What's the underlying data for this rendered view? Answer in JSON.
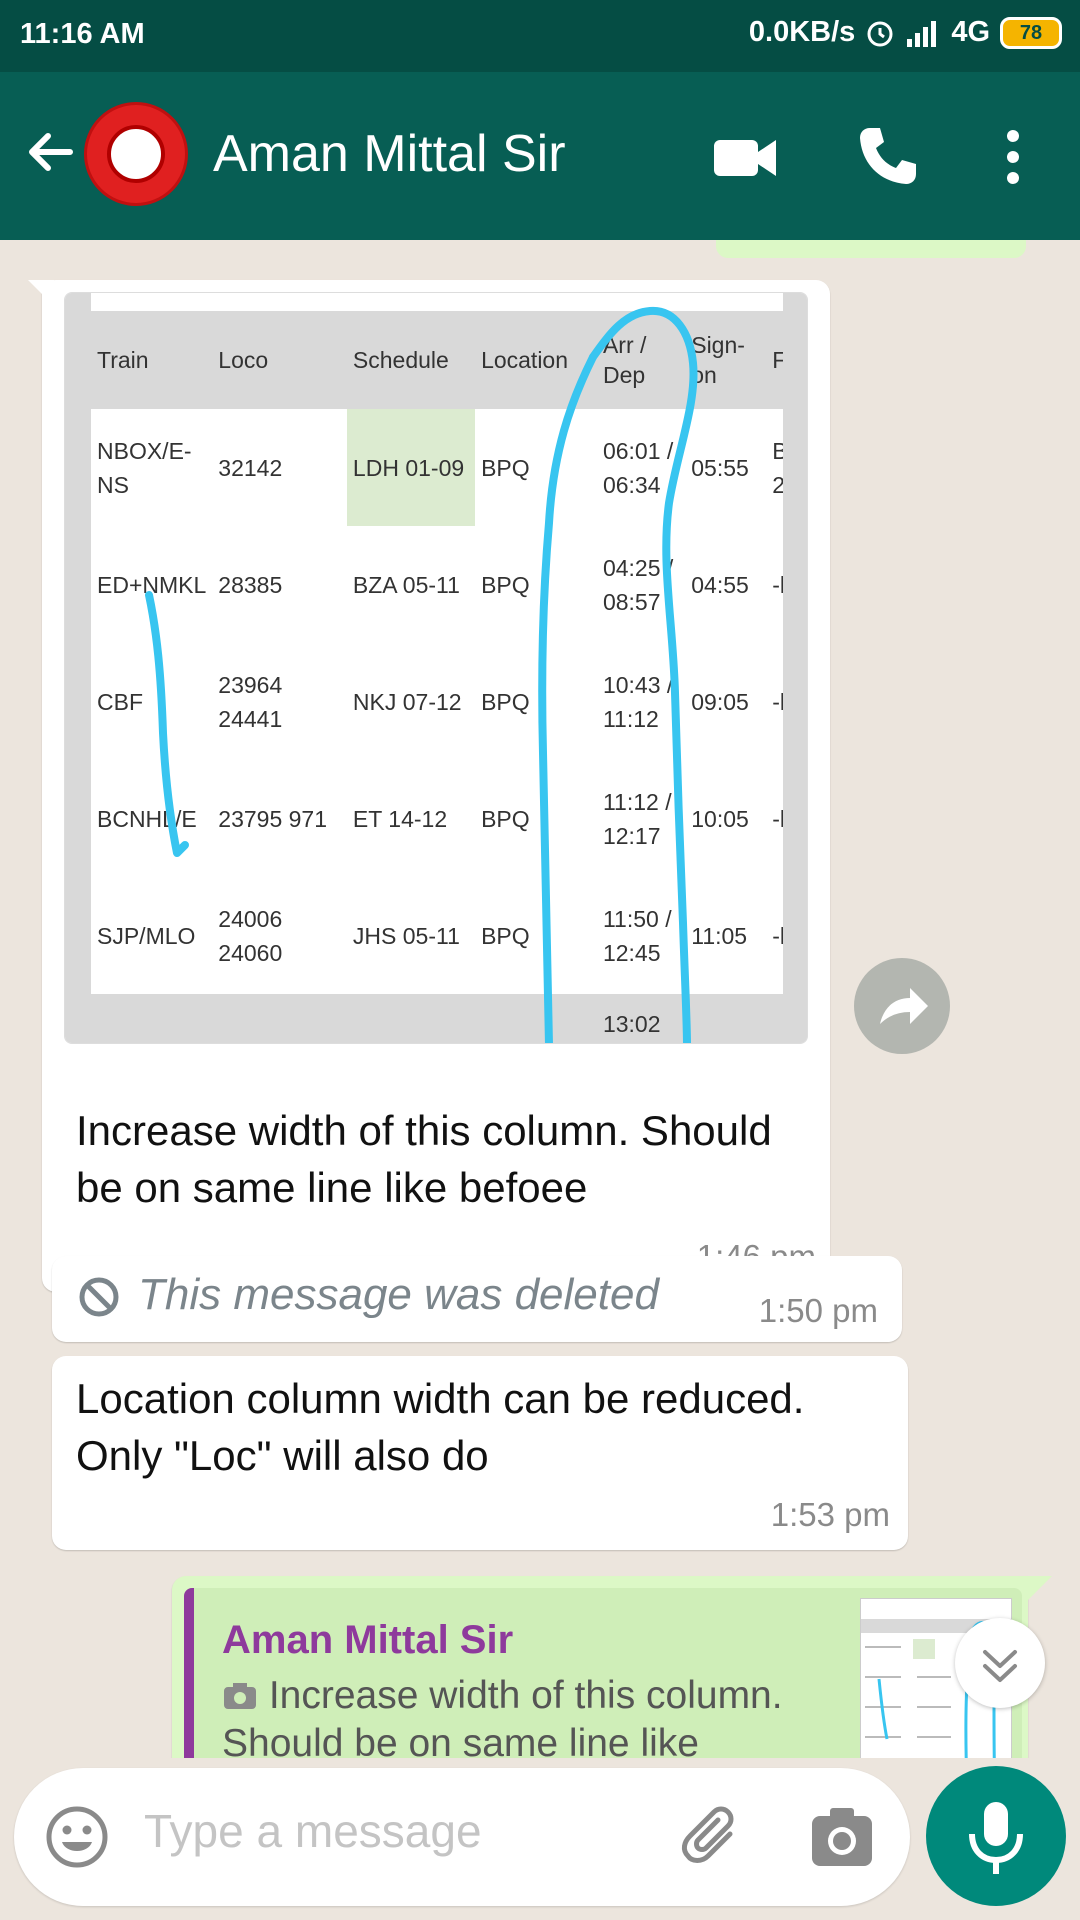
{
  "status_bar": {
    "time": "11:16 AM",
    "network_speed": "0.0KB/s",
    "network_type": "4G",
    "battery": "78"
  },
  "header": {
    "contact_name": "Aman Mittal Sir",
    "icons": [
      "back-arrow-icon",
      "railway-logo-avatar",
      "video-call-icon",
      "phone-call-icon",
      "more-vert-icon"
    ]
  },
  "messages": {
    "image_message": {
      "table": {
        "headers": [
          "Train",
          "Loco",
          "Schedule",
          "Location",
          "Arr / Dep",
          "Sign-on",
          "F"
        ],
        "rows": [
          {
            "train": "NBOX/E-NS",
            "loco": "32142",
            "schedule": "LDH 01-09",
            "location": "BPQ",
            "arrdep": "06:01 / 06:34",
            "signon": "05:55",
            "f": "B 2"
          },
          {
            "train": "ED+NMKL",
            "loco": "28385",
            "schedule": "BZA 05-11",
            "location": "BPQ",
            "arrdep": "04:25 / 08:57",
            "signon": "04:55",
            "f": "-l"
          },
          {
            "train": "CBF",
            "loco": "23964 24441",
            "schedule": "NKJ 07-12",
            "location": "BPQ",
            "arrdep": "10:43 / 11:12",
            "signon": "09:05",
            "f": "-l"
          },
          {
            "train": "BCNHL/E",
            "loco": "23795 971",
            "schedule": "ET 14-12",
            "location": "BPQ",
            "arrdep": "11:12 / 12:17",
            "signon": "10:05",
            "f": "-l"
          },
          {
            "train": "SJP/MLO",
            "loco": "24006 24060",
            "schedule": "JHS 05-11",
            "location": "BPQ",
            "arrdep": "11:50 / 12:45",
            "signon": "11:05",
            "f": "-l"
          },
          {
            "train": "",
            "loco": "",
            "schedule": "",
            "location": "",
            "arrdep": "13:02",
            "signon": "",
            "f": ""
          }
        ]
      },
      "caption": "Increase width of this column. Should be on same line like befoee",
      "time": "1:46 pm"
    },
    "deleted_message": {
      "text": "This message was deleted",
      "time": "1:50 pm"
    },
    "text_message": {
      "text": "Location column width can be reduced. Only \"Loc\" will also do",
      "time": "1:53 pm"
    },
    "reply_message": {
      "quoted_author": "Aman Mittal Sir",
      "quoted_text": "Increase width of this column. Should be on same line like"
    }
  },
  "composer": {
    "placeholder": "Type a message"
  },
  "colors": {
    "status_bar": "#054d44",
    "app_bar": "#075e54",
    "chat_background": "#ece5dd",
    "outgoing_bubble": "#dcf8c6",
    "mic_button": "#00897b",
    "quote_author": "#8e3a9c",
    "annotation_ink": "#38c5f0"
  }
}
